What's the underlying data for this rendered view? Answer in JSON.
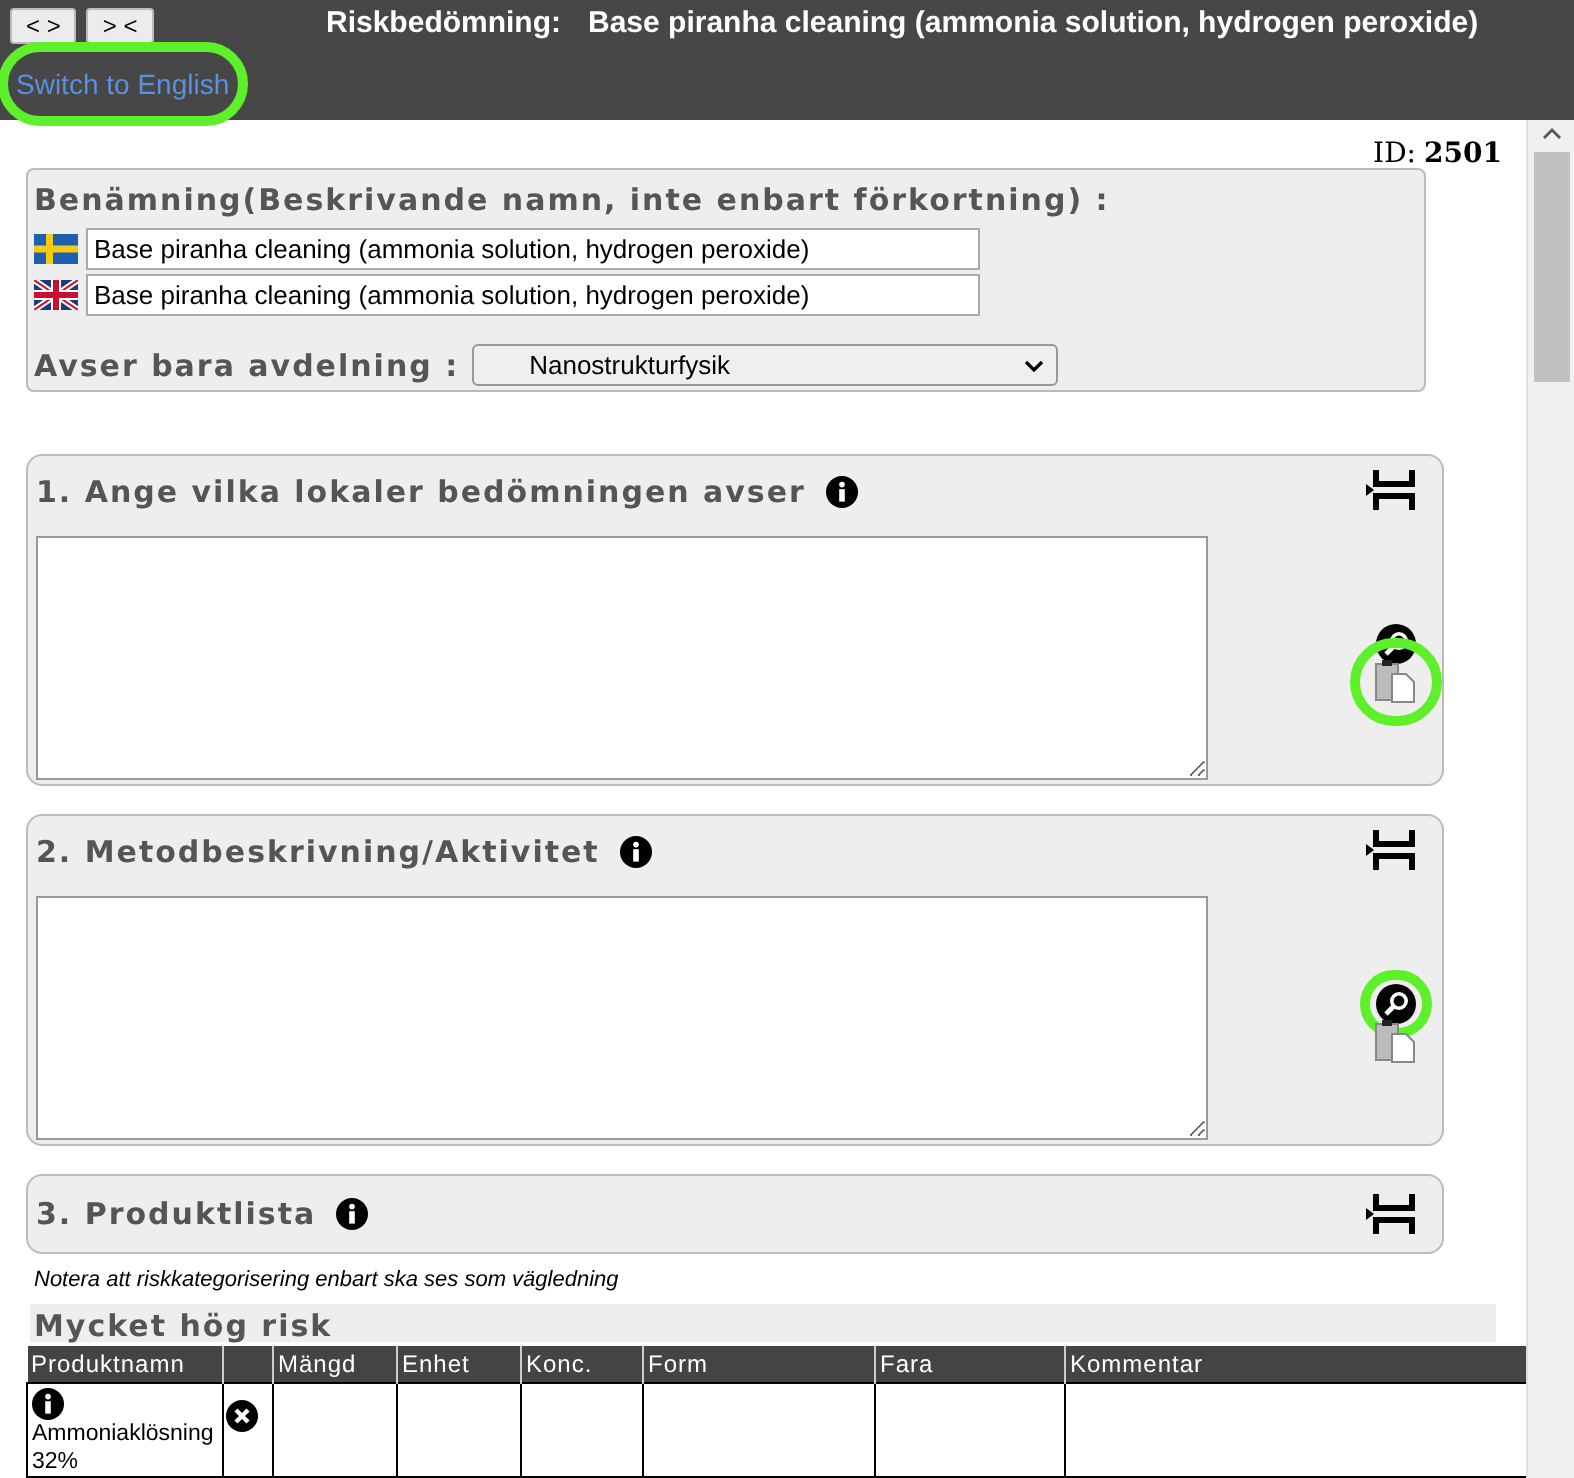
{
  "header": {
    "nav_buttons": [
      "< >",
      "> <"
    ],
    "title_label": "Riskbedömning:",
    "title": "Base piranha cleaning (ammonia solution, hydrogen peroxide)",
    "language_link": {
      "label": "Switch to English",
      "highlighted": true
    }
  },
  "id": {
    "label": "ID:",
    "value": "2501"
  },
  "name_section": {
    "heading": "Benämning(Beskrivande namn, inte enbart förkortning) :",
    "fields": [
      {
        "kind": "se",
        "value": "Base piranha cleaning (ammonia solution, hydrogen peroxide)"
      },
      {
        "kind": "gb",
        "value": "Base piranha cleaning (ammonia solution, hydrogen peroxide)"
      }
    ],
    "department": {
      "label": "Avser bara avdelning :",
      "value": "Nanostrukturfysik"
    }
  },
  "sections": [
    {
      "kind": "textarea",
      "title": "1. Ange vilka lokaler bedömningen avser",
      "search_highlighted": false,
      "paste_highlighted": true
    },
    {
      "kind": "textarea",
      "title": "2. Metodbeskrivning/Aktivitet",
      "search_highlighted": true,
      "paste_highlighted": false
    },
    {
      "kind": "header",
      "title": "3. Produktlista"
    }
  ],
  "note": "Notera att riskkategorisering enbart ska ses som vägledning",
  "risk_group": "Mycket hög risk",
  "table": {
    "columns": [
      "Produktnamn",
      "",
      "Mängd",
      "Enhet",
      "Konc.",
      "Form",
      "Fara",
      "Kommentar"
    ],
    "rows": [
      {
        "name": "Ammoniaklösning 32%"
      }
    ]
  }
}
